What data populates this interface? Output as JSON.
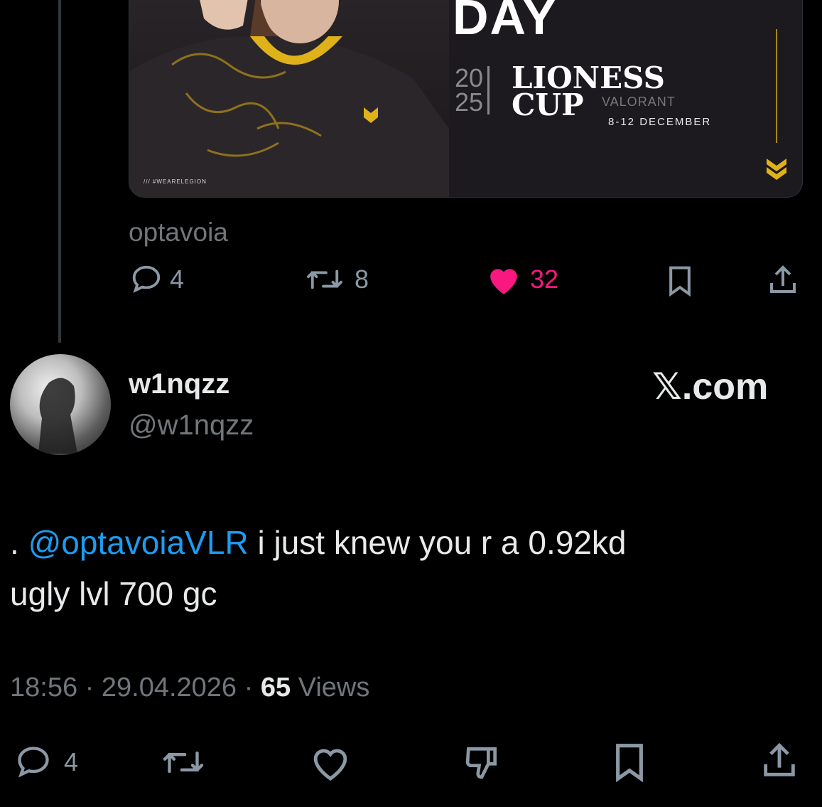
{
  "media": {
    "day_text": "DAY",
    "year_top": "20",
    "year_bottom": "25",
    "event_line1": "LIONESS",
    "event_line2": "CUP",
    "game": "VALORANT",
    "dates": "8-12 DECEMBER",
    "hashtag": "/// #WEARELEGION"
  },
  "quoted_post": {
    "author": "optavoia",
    "replies": "4",
    "reposts": "8",
    "likes": "32"
  },
  "post": {
    "display_name": "w1nqzz",
    "handle": "@w1nqzz",
    "brand": "𝕏.com",
    "text_prefix": ". ",
    "mention": "@optavoiaVLR",
    "text_line1": " i just knew you r a 0.92kd",
    "text_line2": "ugly lvl 700 gc",
    "time": "18:56",
    "date": "29.04.2026",
    "views_count": "65",
    "views_label": "Views",
    "replies": "4"
  },
  "colors": {
    "like": "#f91880",
    "mention": "#1d9bf0",
    "gold": "#f5c518"
  }
}
